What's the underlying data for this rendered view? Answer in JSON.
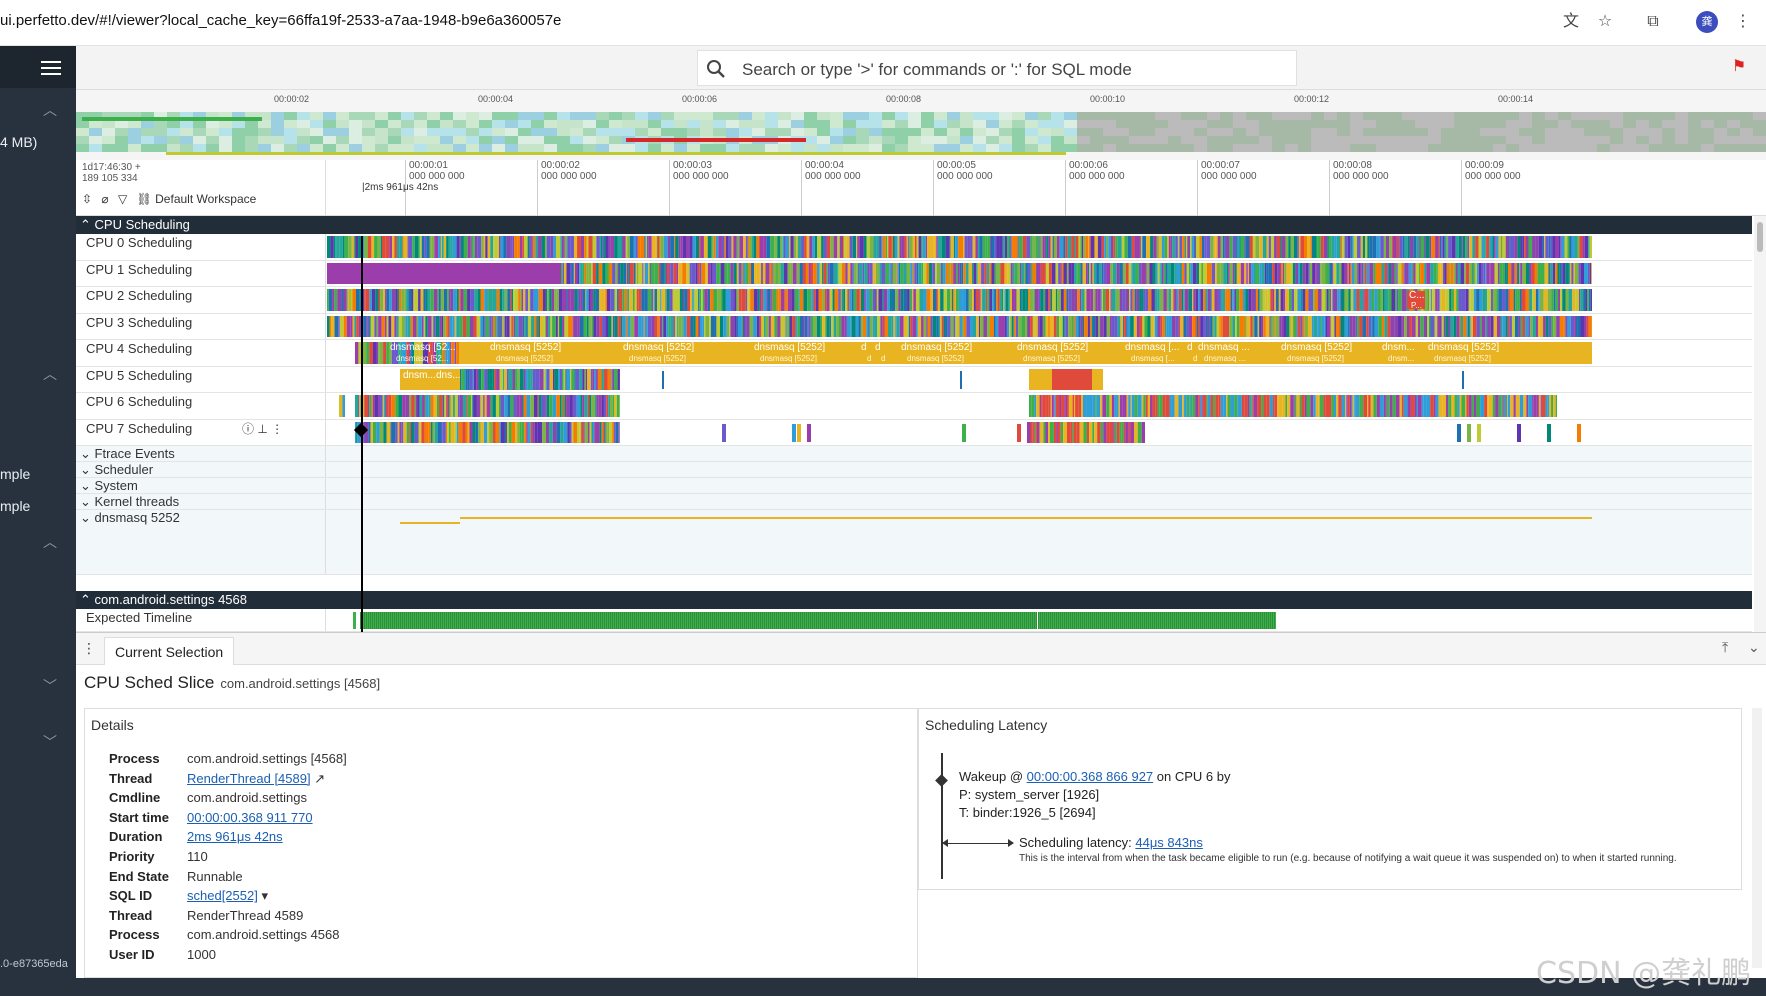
{
  "browser": {
    "url": "ui.perfetto.dev/#!/viewer?local_cache_key=66ffa19f-2533-a7aa-1948-b9e6a360057e",
    "icons": [
      "translate-icon",
      "star-icon",
      "extensions-icon",
      "profile-avatar",
      "more-icon"
    ],
    "avatar_text": "龚"
  },
  "sidebar": {
    "partial_texts": [
      "4 MB)",
      "mple",
      "mple"
    ],
    "version": ".0-e87365eda"
  },
  "search": {
    "placeholder": "Search or type '>' for commands or ':' for SQL mode"
  },
  "overview": {
    "ticks": [
      "00:00:02",
      "00:00:04",
      "00:00:06",
      "00:00:08",
      "00:00:10",
      "00:00:12",
      "00:00:14"
    ]
  },
  "timeaxis": {
    "start_time": "1d17:46:30 +",
    "start_ns": "189 105 334",
    "workspace": "Default Workspace",
    "selection_duration": "2ms 961μs 42ns",
    "ticks": [
      {
        "t": "00:00:01",
        "ns": "000 000 000"
      },
      {
        "t": "00:00:02",
        "ns": "000 000 000"
      },
      {
        "t": "00:00:03",
        "ns": "000 000 000"
      },
      {
        "t": "00:00:04",
        "ns": "000 000 000"
      },
      {
        "t": "00:00:05",
        "ns": "000 000 000"
      },
      {
        "t": "00:00:06",
        "ns": "000 000 000"
      },
      {
        "t": "00:00:07",
        "ns": "000 000 000"
      },
      {
        "t": "00:00:08",
        "ns": "000 000 000"
      },
      {
        "t": "00:00:09",
        "ns": "000 000 000"
      }
    ]
  },
  "tracks": {
    "cpu_group": "CPU Scheduling",
    "cpus": [
      "CPU 0 Scheduling",
      "CPU 1 Scheduling",
      "CPU 2 Scheduling",
      "CPU 3 Scheduling",
      "CPU 4 Scheduling",
      "CPU 5 Scheduling",
      "CPU 6 Scheduling",
      "CPU 7 Scheduling"
    ],
    "collapsed": [
      "Ftrace Events",
      "Scheduler",
      "System",
      "Kernel threads",
      "dnsmasq 5252"
    ],
    "process_group": "com.android.settings 4568",
    "expected_timeline": "Expected Timeline",
    "cpu4_labels": [
      "dnsmasq [52...",
      "dnsmasq [5252]",
      "dnsmasq [5252]",
      "dnsmasq [5252]",
      "d",
      "d",
      "dnsmasq [5252]",
      "dnsmasq [5252]",
      "dnsmasq [...",
      "d",
      "dnsmasq ...",
      "dnsmasq [5252]",
      "dnsm...",
      "dnsmasq [5252]"
    ],
    "cpu4_sublabels": [
      "dnsmasq [52...",
      "dnsmasq [5252]",
      "dnsmasq [5252]",
      "dnsmasq [5252]",
      "d",
      "d",
      "dnsmasq [5252]",
      "dnsmasq [5252]",
      "dnsmasq [...",
      "d",
      "dnsmasq ...",
      "dnsmasq [5252]",
      "dnsm...",
      "dnsmasq [5252]"
    ],
    "cpu5_labels": [
      "dnsm...",
      "dns..."
    ],
    "cpu2_marker": "C...",
    "cpu2_marker_sub": "P..."
  },
  "details": {
    "tab": "Current Selection",
    "title": "CPU Sched Slice",
    "subtitle": "com.android.settings [4568]",
    "details_title": "Details",
    "rows": [
      {
        "k": "Process",
        "v": "com.android.settings [4568]"
      },
      {
        "k": "Thread",
        "v": "RenderThread [4589]"
      },
      {
        "k": "Cmdline",
        "v": "com.android.settings"
      },
      {
        "k": "Start time",
        "v": "00:00:00.368 911 770"
      },
      {
        "k": "Duration",
        "v": "2ms 961μs 42ns"
      },
      {
        "k": "Priority",
        "v": "110"
      },
      {
        "k": "End State",
        "v": "Runnable"
      },
      {
        "k": "SQL ID",
        "v": "sched[2552]"
      },
      {
        "k": "Thread",
        "v": "RenderThread 4589"
      },
      {
        "k": "Process",
        "v": "com.android.settings 4568"
      },
      {
        "k": "User ID",
        "v": "1000"
      }
    ],
    "latency_title": "Scheduling Latency",
    "wakeup_prefix": "Wakeup @ ",
    "wakeup_time": "00:00:00.368 866 927",
    "wakeup_suffix": " on CPU 6 by",
    "wakeup_process": "P: system_server [1926]",
    "wakeup_thread": "T: binder:1926_5 [2694]",
    "latency_label": "Scheduling latency: ",
    "latency_value": "44μs 843ns",
    "latency_desc": "This is the interval from when the task became eligible to run (e.g. because of notifying a wait queue it was suspended on) to when it started running."
  },
  "watermark": "CSDN @龚礼鹏",
  "colors": {
    "dnsmasq": "#e9b422",
    "cpu1_purple": "#9b3dab",
    "settings_red": "#e04a3b",
    "expected_green": "#3db04b",
    "header_dark": "#222d3a",
    "link": "#1a5fb4"
  }
}
